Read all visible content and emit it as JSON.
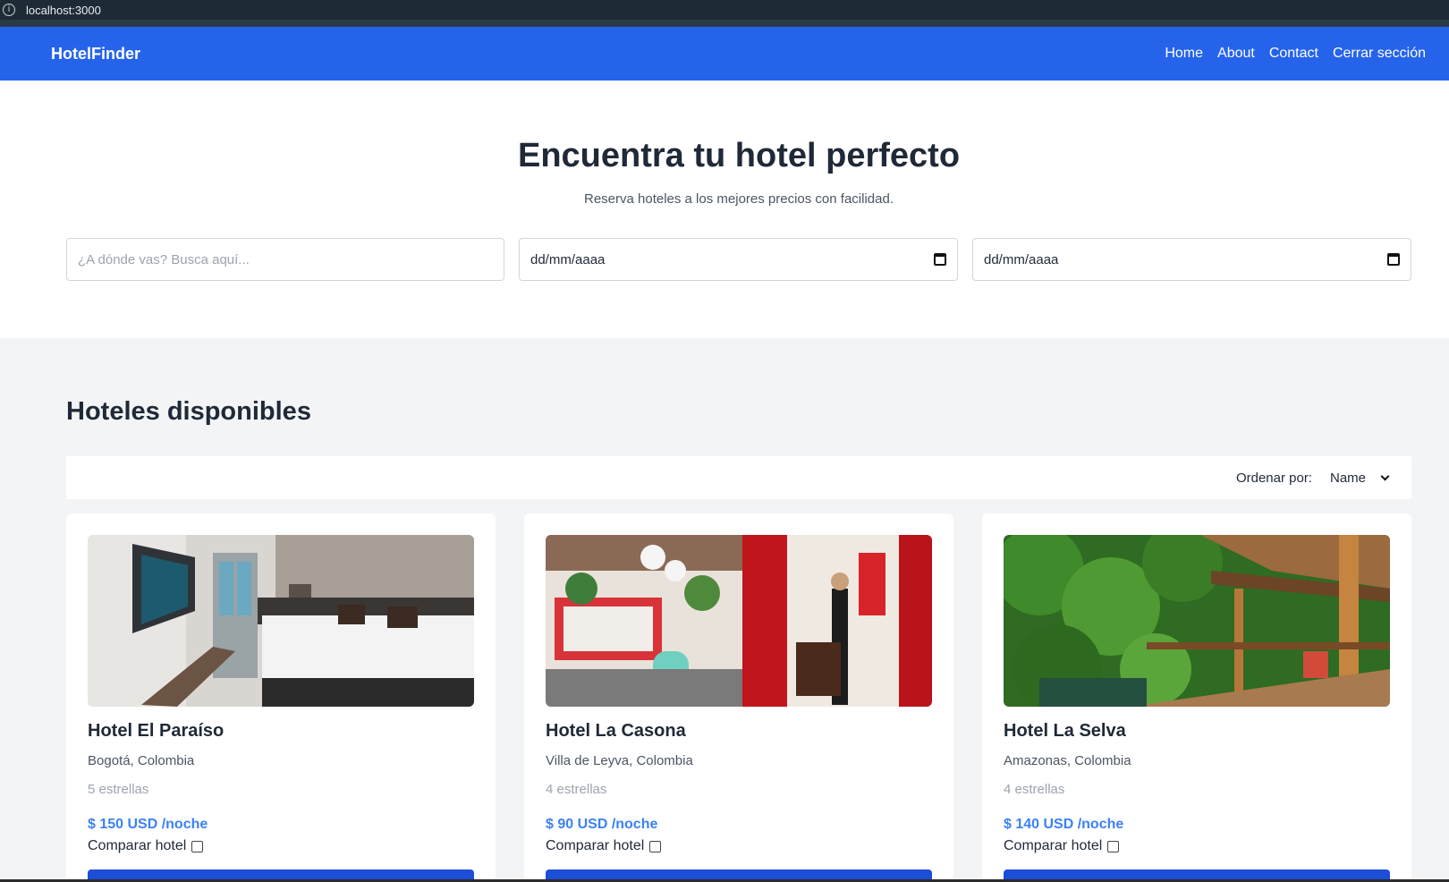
{
  "browser": {
    "url": "localhost:3000"
  },
  "navbar": {
    "brand": "HotelFinder",
    "links": [
      "Home",
      "About",
      "Contact",
      "Cerrar sección"
    ]
  },
  "hero": {
    "title": "Encuentra tu hotel perfecto",
    "subtitle": "Reserva hoteles a los mejores precios con facilidad.",
    "search_placeholder": "¿A dónde vas? Busca aquí...",
    "checkin_placeholder": "dd/mm/aaaa",
    "checkout_placeholder": "dd/mm/aaaa"
  },
  "listing": {
    "title": "Hoteles disponibles",
    "sort_label": "Ordenar por:",
    "sort_value": "Name",
    "hotels": [
      {
        "name": "Hotel El Paraíso",
        "location": "Bogotá, Colombia",
        "stars": "5 estrellas",
        "price": "$ 150 USD /noche",
        "compare_label": "Comparar hotel",
        "image": "hotel-room-photo"
      },
      {
        "name": "Hotel La Casona",
        "location": "Villa de Leyva, Colombia",
        "stars": "4 estrellas",
        "price": "$ 90 USD /noche",
        "compare_label": "Comparar hotel",
        "image": "colonial-courtyard-photo"
      },
      {
        "name": "Hotel La Selva",
        "location": "Amazonas, Colombia",
        "stars": "4 estrellas",
        "price": "$ 140 USD /noche",
        "compare_label": "Comparar hotel",
        "image": "jungle-deck-photo"
      }
    ]
  },
  "colors": {
    "primary": "#2563eb",
    "price": "#3b82f6",
    "section_bg": "#f3f4f6"
  }
}
